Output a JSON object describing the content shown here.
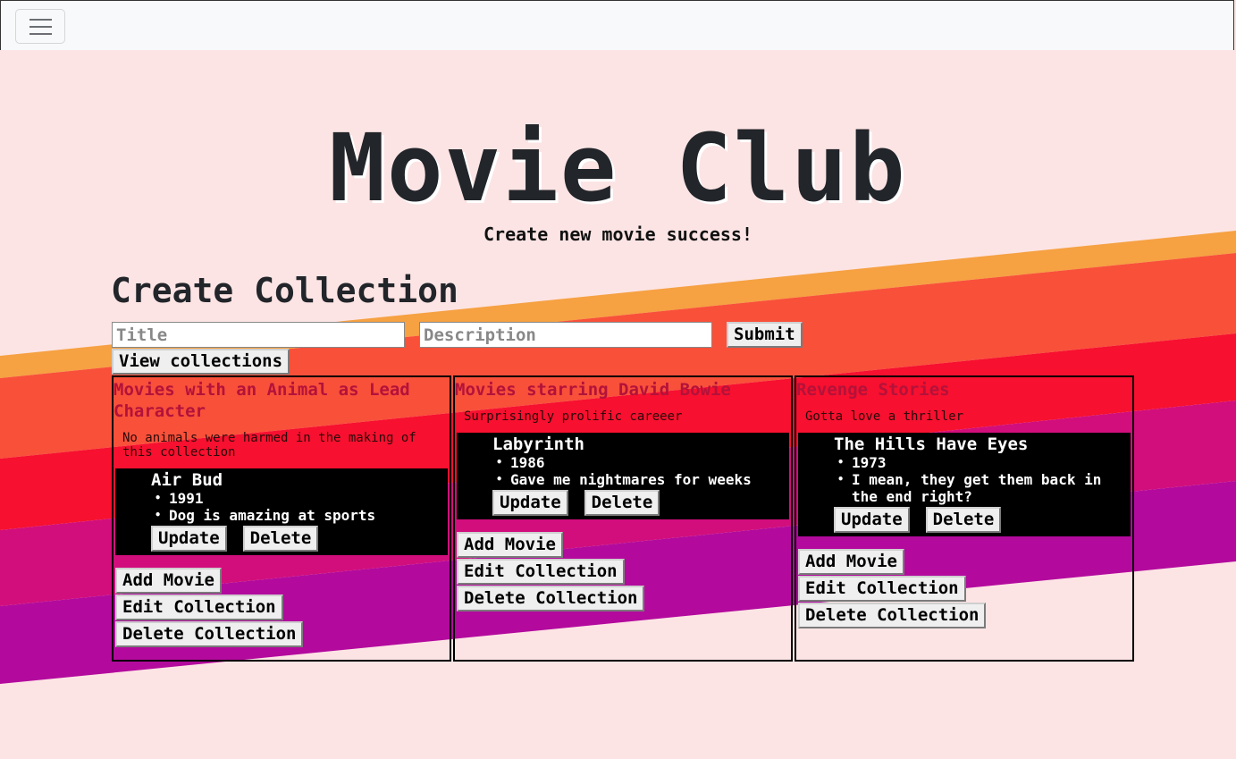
{
  "colors": {
    "background": "#fce4e4",
    "stripe_orange": "#f6a142",
    "stripe_red_orange": "#f9503a",
    "stripe_red": "#f7102f",
    "stripe_magenta": "#d20e7c",
    "stripe_purple": "#b30a9d",
    "card_title": "#b3123a",
    "title_text": "#22252a"
  },
  "navbar": {
    "toggle_icon": "hamburger-icon"
  },
  "hero": {
    "title": "Movie Club",
    "status_message": "Create new movie success!"
  },
  "create_collection": {
    "heading": "Create Collection",
    "title_placeholder": "Title",
    "description_placeholder": "Description",
    "submit_label": "Submit",
    "view_label": "View collections"
  },
  "collections": [
    {
      "title": "Movies with an Animal as Lead Character",
      "description": "No animals were harmed in the making of this collection",
      "movies": [
        {
          "title": "Air Bud",
          "details": [
            "1991",
            "Dog is amazing at sports"
          ],
          "update_label": "Update",
          "delete_label": "Delete"
        }
      ],
      "add_movie_label": "Add Movie",
      "edit_label": "Edit Collection",
      "delete_label": "Delete Collection"
    },
    {
      "title": "Movies starring David Bowie",
      "description": "Surprisingly prolific careeer",
      "movies": [
        {
          "title": "Labyrinth",
          "details": [
            "1986",
            "Gave me nightmares for weeks"
          ],
          "update_label": "Update",
          "delete_label": "Delete"
        }
      ],
      "add_movie_label": "Add Movie",
      "edit_label": "Edit Collection",
      "delete_label": "Delete Collection"
    },
    {
      "title": "Revenge Stories",
      "description": "Gotta love a thriller",
      "movies": [
        {
          "title": "The Hills Have Eyes",
          "details": [
            "1973",
            "I mean, they get them back in the end right?"
          ],
          "update_label": "Update",
          "delete_label": "Delete"
        }
      ],
      "add_movie_label": "Add Movie",
      "edit_label": "Edit Collection",
      "delete_label": "Delete Collection"
    }
  ]
}
